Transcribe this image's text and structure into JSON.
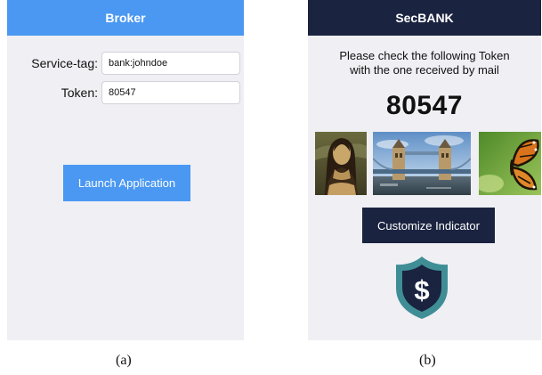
{
  "broker": {
    "title": "Broker",
    "service_tag_label": "Service-tag:",
    "service_tag_value": "bank:johndoe",
    "token_label": "Token:",
    "token_value": "80547",
    "launch_label": "Launch Application",
    "accent_color": "#4a98f2"
  },
  "secbank": {
    "title": "SecBANK",
    "instruction_line1": "Please check the following Token",
    "instruction_line2": "with the one received by mail",
    "token": "80547",
    "images": [
      "mona-lisa-image",
      "tower-bridge-image",
      "butterfly-image"
    ],
    "customize_label": "Customize Indicator",
    "indicator_icon": "dollar-shield-icon",
    "accent_color": "#1a2340"
  },
  "captions": {
    "a": "(a)",
    "b": "(b)"
  }
}
